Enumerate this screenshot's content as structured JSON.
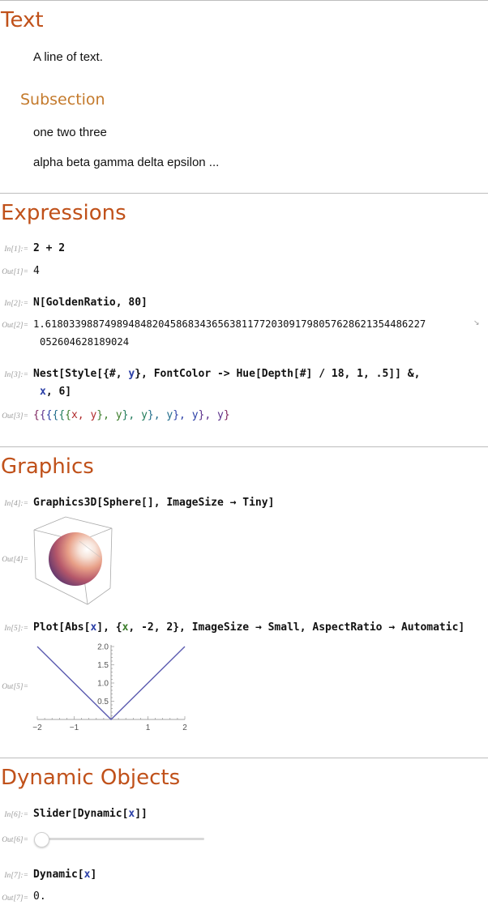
{
  "sections": {
    "text": {
      "title": "Text",
      "line1": "A line of text.",
      "subsection": {
        "title": "Subsection",
        "line1": "one two three",
        "line2": "alpha beta gamma delta epsilon ..."
      }
    },
    "expressions": {
      "title": "Expressions",
      "in1": {
        "label": "In[1]:=",
        "code": "2 + 2"
      },
      "out1": {
        "label": "Out[1]=",
        "value": "4"
      },
      "in2": {
        "label": "In[2]:=",
        "code": "N[GoldenRatio, 80]"
      },
      "out2": {
        "label": "Out[2]=",
        "line1": "1.6180339887498948482045868343656381177203091798057628621354486227",
        "line2": "052604628189024"
      },
      "in3": {
        "label": "In[3]:=",
        "line1": {
          "a": "Nest[Style[{#, ",
          "b": "y",
          "c": "}, FontColor -> Hue[Depth[#] / 18, 1, .5]] &,"
        },
        "line2": {
          "a": "x",
          "b": ", 6]"
        }
      },
      "out3": {
        "label": "Out[3]="
      }
    },
    "graphics": {
      "title": "Graphics",
      "in4": {
        "label": "In[4]:=",
        "code": "Graphics3D[Sphere[], ImageSize → Tiny]"
      },
      "out4": {
        "label": "Out[4]="
      },
      "in5": {
        "label": "In[5]:=",
        "code_a": "Plot[Abs[",
        "code_x1": "x",
        "code_b": "], {",
        "code_x2": "x",
        "code_c": ", -2, 2}, ImageSize → Small, AspectRatio → Automatic]"
      },
      "out5": {
        "label": "Out[5]="
      }
    },
    "dynamic": {
      "title": "Dynamic Objects",
      "in6": {
        "label": "In[6]:=",
        "code_a": "Slider[Dynamic[",
        "code_x": "x",
        "code_b": "]]"
      },
      "out6": {
        "label": "Out[6]=",
        "slider_value": 0
      },
      "in7": {
        "label": "In[7]:=",
        "code_a": "Dynamic[",
        "code_x": "x",
        "code_b": "]"
      },
      "out7": {
        "label": "Out[7]=",
        "value": "0."
      }
    }
  },
  "nest_output": [
    {
      "text": "{",
      "color": "#7a1f5a"
    },
    {
      "text": "{",
      "color": "#5a2f8a"
    },
    {
      "text": "{",
      "color": "#2a3ea6"
    },
    {
      "text": "{",
      "color": "#1f6b8a"
    },
    {
      "text": "{",
      "color": "#1f7a5a"
    },
    {
      "text": "{",
      "color": "#3b7d2a"
    },
    {
      "text": "x, y",
      "color": "#b02a2a"
    },
    {
      "text": "}",
      "color": "#3b7d2a"
    },
    {
      "text": ", y",
      "color": "#3b7d2a"
    },
    {
      "text": "}",
      "color": "#1f7a5a"
    },
    {
      "text": ", y",
      "color": "#1f7a5a"
    },
    {
      "text": "}",
      "color": "#1f6b8a"
    },
    {
      "text": ", y",
      "color": "#1f6b8a"
    },
    {
      "text": "}",
      "color": "#2a3ea6"
    },
    {
      "text": ", y",
      "color": "#2a3ea6"
    },
    {
      "text": "}",
      "color": "#5a2f8a"
    },
    {
      "text": ", y",
      "color": "#5a2f8a"
    },
    {
      "text": "}",
      "color": "#7a1f5a"
    }
  ],
  "chart_data": {
    "type": "line",
    "x": [
      -2,
      -1.5,
      -1,
      -0.5,
      0,
      0.5,
      1,
      1.5,
      2
    ],
    "series": [
      {
        "values": [
          2,
          1.5,
          1,
          0.5,
          0,
          0.5,
          1,
          1.5,
          2
        ]
      }
    ],
    "xticks": [
      "-2",
      "-1",
      "1",
      "2"
    ],
    "yticks": [
      "0.5",
      "1.0",
      "1.5",
      "2.0"
    ],
    "xlim": [
      -2,
      2
    ],
    "ylim": [
      0,
      2
    ],
    "line_color": "#5b5bb0"
  },
  "colors": {
    "section": "#c0511a",
    "subsection": "#c47a2c",
    "symbol_blue": "#2a3ea6",
    "symbol_green": "#3b7d2a"
  }
}
